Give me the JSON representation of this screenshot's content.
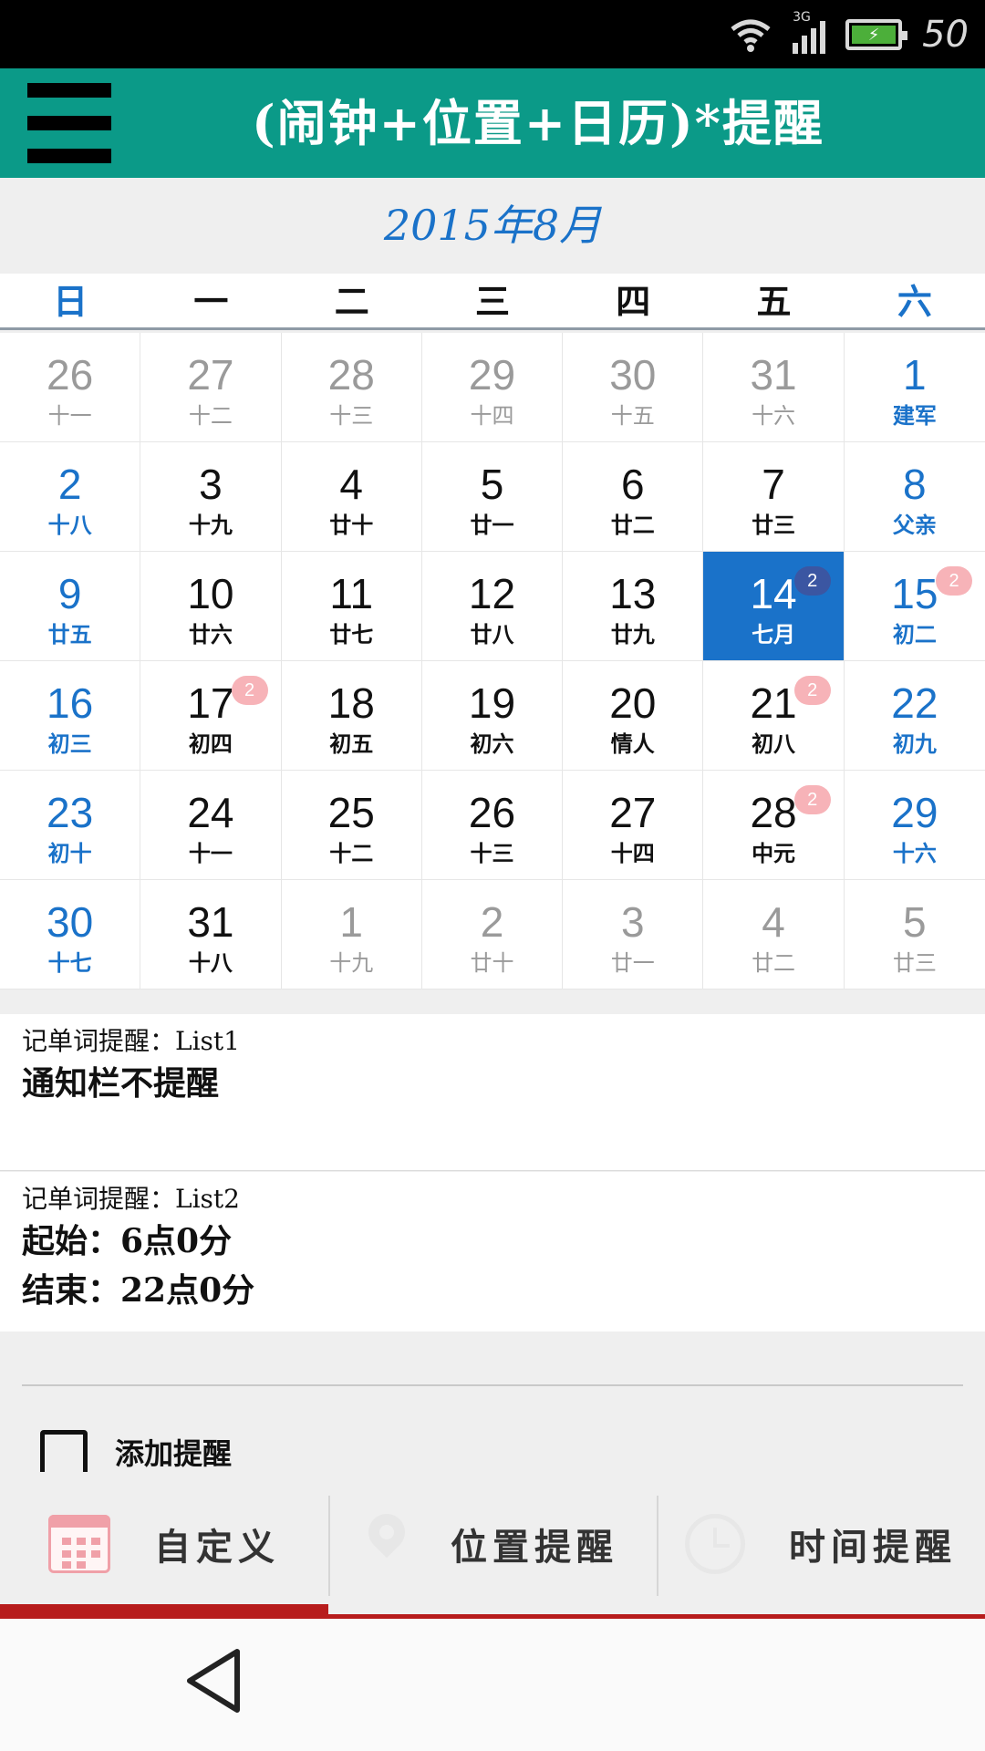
{
  "status_bar": {
    "network": "3G",
    "time": "50"
  },
  "header": {
    "title": "(闹钟+位置+日历)*提醒"
  },
  "calendar": {
    "month_title": "2015年8月",
    "weekdays": [
      "日",
      "一",
      "二",
      "三",
      "四",
      "五",
      "六"
    ],
    "days": [
      {
        "num": "26",
        "lunar": "十一",
        "other": true
      },
      {
        "num": "27",
        "lunar": "十二",
        "other": true
      },
      {
        "num": "28",
        "lunar": "十三",
        "other": true
      },
      {
        "num": "29",
        "lunar": "十四",
        "other": true
      },
      {
        "num": "30",
        "lunar": "十五",
        "other": true
      },
      {
        "num": "31",
        "lunar": "十六",
        "other": true
      },
      {
        "num": "1",
        "lunar": "建军"
      },
      {
        "num": "2",
        "lunar": "十八"
      },
      {
        "num": "3",
        "lunar": "十九"
      },
      {
        "num": "4",
        "lunar": "廿十"
      },
      {
        "num": "5",
        "lunar": "廿一"
      },
      {
        "num": "6",
        "lunar": "廿二"
      },
      {
        "num": "7",
        "lunar": "廿三"
      },
      {
        "num": "8",
        "lunar": "父亲"
      },
      {
        "num": "9",
        "lunar": "廿五"
      },
      {
        "num": "10",
        "lunar": "廿六"
      },
      {
        "num": "11",
        "lunar": "廿七"
      },
      {
        "num": "12",
        "lunar": "廿八"
      },
      {
        "num": "13",
        "lunar": "廿九"
      },
      {
        "num": "14",
        "lunar": "七月",
        "today": true,
        "badge": "2"
      },
      {
        "num": "15",
        "lunar": "初二",
        "badge": "2"
      },
      {
        "num": "16",
        "lunar": "初三"
      },
      {
        "num": "17",
        "lunar": "初四",
        "badge": "2"
      },
      {
        "num": "18",
        "lunar": "初五"
      },
      {
        "num": "19",
        "lunar": "初六"
      },
      {
        "num": "20",
        "lunar": "情人"
      },
      {
        "num": "21",
        "lunar": "初八",
        "badge": "2"
      },
      {
        "num": "22",
        "lunar": "初九"
      },
      {
        "num": "23",
        "lunar": "初十"
      },
      {
        "num": "24",
        "lunar": "十一"
      },
      {
        "num": "25",
        "lunar": "十二"
      },
      {
        "num": "26",
        "lunar": "十三"
      },
      {
        "num": "27",
        "lunar": "十四"
      },
      {
        "num": "28",
        "lunar": "中元",
        "badge": "2"
      },
      {
        "num": "29",
        "lunar": "十六"
      },
      {
        "num": "30",
        "lunar": "十七"
      },
      {
        "num": "31",
        "lunar": "十八"
      },
      {
        "num": "1",
        "lunar": "十九",
        "other": true
      },
      {
        "num": "2",
        "lunar": "廿十",
        "other": true
      },
      {
        "num": "3",
        "lunar": "廿一",
        "other": true
      },
      {
        "num": "4",
        "lunar": "廿二",
        "other": true
      },
      {
        "num": "5",
        "lunar": "廿三",
        "other": true
      }
    ]
  },
  "reminders": [
    {
      "label": "记单词提醒：List1",
      "lines": [
        "通知栏不提醒"
      ]
    },
    {
      "label": "记单词提醒：List2",
      "lines": [
        "起始：6点0分",
        "结束：22点0分"
      ]
    }
  ],
  "add_reminder": {
    "label": "添加提醒",
    "checked": false
  },
  "tabs": [
    {
      "label": "自定义",
      "icon": "calendar-icon",
      "active": true
    },
    {
      "label": "位置提醒",
      "icon": "location-pin-icon",
      "active": false
    },
    {
      "label": "时间提醒",
      "icon": "alarm-clock-icon",
      "active": false
    }
  ],
  "colors": {
    "header": "#0b9a88",
    "accent_blue": "#1a72c9",
    "badge": "#f7b3b8",
    "tab_indicator": "#b71c1c"
  }
}
